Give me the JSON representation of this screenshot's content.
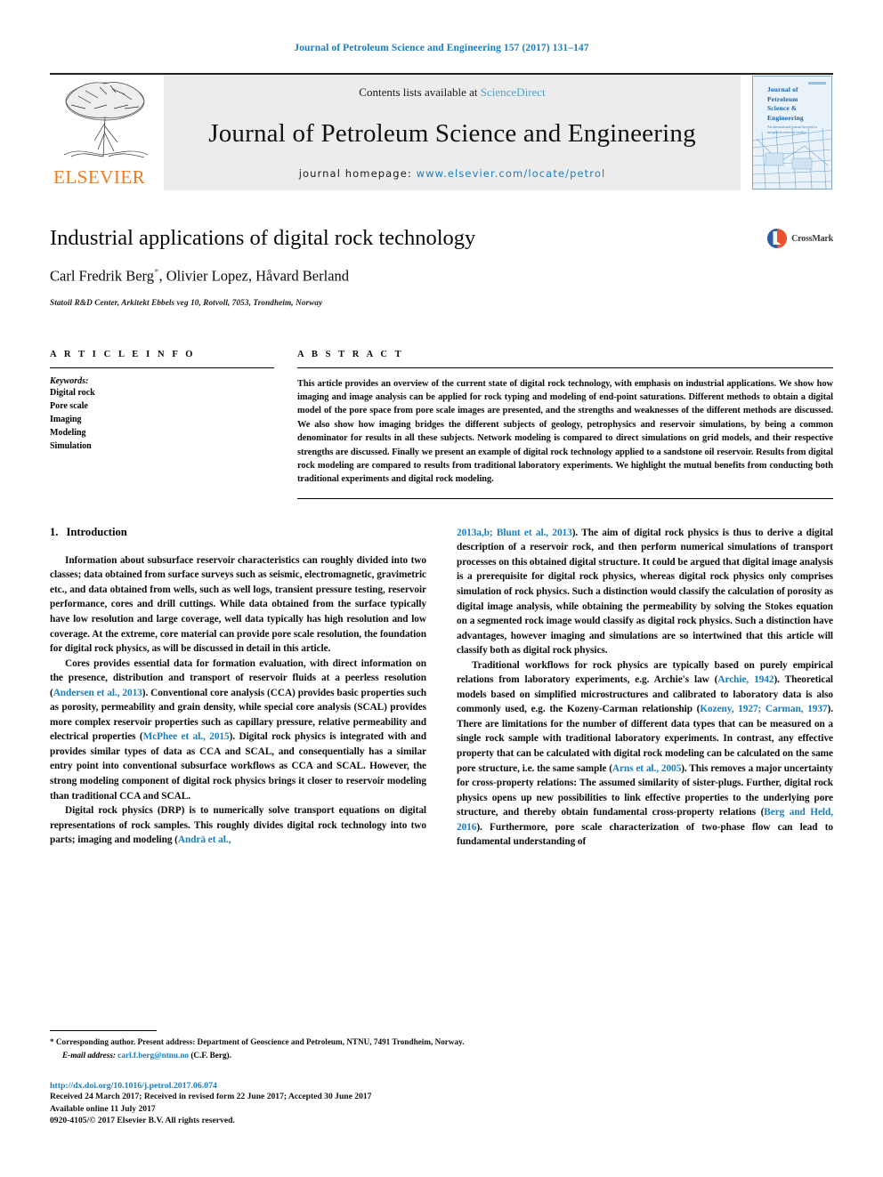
{
  "running_head": "Journal of Petroleum Science and Engineering 157 (2017) 131–147",
  "masthead": {
    "publisher_name": "ELSEVIER",
    "contents_prefix": "Contents lists available at",
    "contents_link": "ScienceDirect",
    "journal_name": "Journal of Petroleum Science and Engineering",
    "homepage_prefix": "journal homepage:",
    "homepage_url": "www.elsevier.com/locate/petrol",
    "cover_title_lines": [
      "Journal of",
      "Petroleum",
      "Science &",
      "Engineering"
    ],
    "cover_subtitle": "An international journal devoted to integrated reservoir studies"
  },
  "article": {
    "title": "Industrial applications of digital rock technology",
    "authors": "Carl Fredrik Berg",
    "authors_rest": ", Olivier Lopez, Håvard Berland",
    "corresponding_marker": "*",
    "affiliation": "Statoil R&D Center, Arkitekt Ebbels veg 10, Rotvoll, 7053, Trondheim, Norway",
    "crossmark_label": "CrossMark"
  },
  "article_info": {
    "heading": "A R T I C L E   I N F O",
    "keywords_label": "Keywords:",
    "keywords": [
      "Digital rock",
      "Pore scale",
      "Imaging",
      "Modeling",
      "Simulation"
    ]
  },
  "abstract": {
    "heading": "A B S T R A C T",
    "text": "This article provides an overview of the current state of digital rock technology, with emphasis on industrial applications. We show how imaging and image analysis can be applied for rock typing and modeling of end-point saturations. Different methods to obtain a digital model of the pore space from pore scale images are presented, and the strengths and weaknesses of the different methods are discussed. We also show how imaging bridges the different subjects of geology, petrophysics and reservoir simulations, by being a common denominator for results in all these subjects. Network modeling is compared to direct simulations on grid models, and their respective strengths are discussed. Finally we present an example of digital rock technology applied to a sandstone oil reservoir. Results from digital rock modeling are compared to results from traditional laboratory experiments. We highlight the mutual benefits from conducting both traditional experiments and digital rock modeling."
  },
  "body": {
    "section_number": "1.",
    "section_title": "Introduction",
    "left_paragraphs": [
      {
        "segments": [
          {
            "t": "Information about subsurface reservoir characteristics can roughly divided into two classes; data obtained from surface surveys such as seismic, electromagnetic, gravimetric etc., and data obtained from wells, such as well logs, transient pressure testing, reservoir performance, cores and drill cuttings. While data obtained from the surface typically have low resolution and large coverage, well data typically has high resolution and low coverage. At the extreme, core material can provide pore scale resolution, the foundation for digital rock physics, as will be discussed in detail in this article."
          }
        ]
      },
      {
        "segments": [
          {
            "t": "Cores provides essential data for formation evaluation, with direct information on the presence, distribution and transport of reservoir fluids at a peerless resolution ("
          },
          {
            "t": "Andersen et al., 2013",
            "cite": true
          },
          {
            "t": "). Conventional core analysis (CCA) provides basic properties such as porosity, permeability and grain density, while special core analysis (SCAL) provides more complex reservoir properties such as capillary pressure, relative permeability and electrical properties ("
          },
          {
            "t": "McPhee et al., 2015",
            "cite": true
          },
          {
            "t": "). Digital rock physics is integrated with and provides similar types of data as CCA and SCAL, and consequentially has a similar entry point into conventional subsurface workflows as CCA and SCAL. However, the strong modeling component of digital rock physics brings it closer to reservoir modeling than traditional CCA and SCAL."
          }
        ]
      },
      {
        "segments": [
          {
            "t": "Digital rock physics (DRP) is to numerically solve transport equations on digital representations of rock samples. This roughly divides digital rock technology into two parts; imaging and modeling ("
          },
          {
            "t": "Andrä et al.,",
            "cite": true
          }
        ]
      }
    ],
    "right_paragraphs": [
      {
        "segments": [
          {
            "t": "2013a,b; Blunt et al., 2013",
            "cite": true
          },
          {
            "t": "). The aim of digital rock physics is thus to derive a digital description of a reservoir rock, and then perform numerical simulations of transport processes on this obtained digital structure. It could be argued that digital image analysis is a prerequisite for digital rock physics, whereas digital rock physics only comprises simulation of rock physics. Such a distinction would classify the calculation of porosity as digital image analysis, while obtaining the permeability by solving the Stokes equation on a segmented rock image would classify as digital rock physics. Such a distinction have advantages, however imaging and simulations are so intertwined that this article will classify both as digital rock physics."
          }
        ],
        "continuation": true
      },
      {
        "segments": [
          {
            "t": "Traditional workflows for rock physics are typically based on purely empirical relations from laboratory experiments, e.g. Archie's law ("
          },
          {
            "t": "Archie, 1942",
            "cite": true
          },
          {
            "t": "). Theoretical models based on simplified microstructures and calibrated to laboratory data is also commonly used, e.g. the Kozeny-Carman relationship ("
          },
          {
            "t": "Kozeny, 1927; Carman, 1937",
            "cite": true
          },
          {
            "t": "). There are limitations for the number of different data types that can be measured on a single rock sample with traditional laboratory experiments. In contrast, any effective property that can be calculated with digital rock modeling can be calculated on the same pore structure, i.e. the same sample ("
          },
          {
            "t": "Arns et al., 2005",
            "cite": true
          },
          {
            "t": "). This removes a major uncertainty for cross-property relations: The assumed similarity of sister-plugs. Further, digital rock physics opens up new possibilities to link effective properties to the underlying pore structure, and thereby obtain fundamental cross-property relations ("
          },
          {
            "t": "Berg and Held, 2016",
            "cite": true
          },
          {
            "t": "). Furthermore, pore scale characterization of two-phase flow can lead to fundamental understanding of"
          }
        ]
      }
    ]
  },
  "footer": {
    "corresponding_note": "* Corresponding author. Present address: Department of Geoscience and Petroleum, NTNU, 7491 Trondheim, Norway.",
    "email_label": "E-mail address:",
    "email": "carl.f.berg@ntnu.no",
    "email_suffix": "(C.F. Berg).",
    "doi": "http://dx.doi.org/10.1016/j.petrol.2017.06.074",
    "history": "Received 24 March 2017; Received in revised form 22 June 2017; Accepted 30 June 2017",
    "available_online": "Available online 11 July 2017",
    "copyright": "0920-4105/© 2017 Elsevier B.V. All rights reserved."
  },
  "colors": {
    "link_blue": "#1a7dbf",
    "sciencedirect_blue": "#4ea3d4",
    "elsevier_orange": "#ef7c22",
    "masthead_gray": "#ececec"
  }
}
